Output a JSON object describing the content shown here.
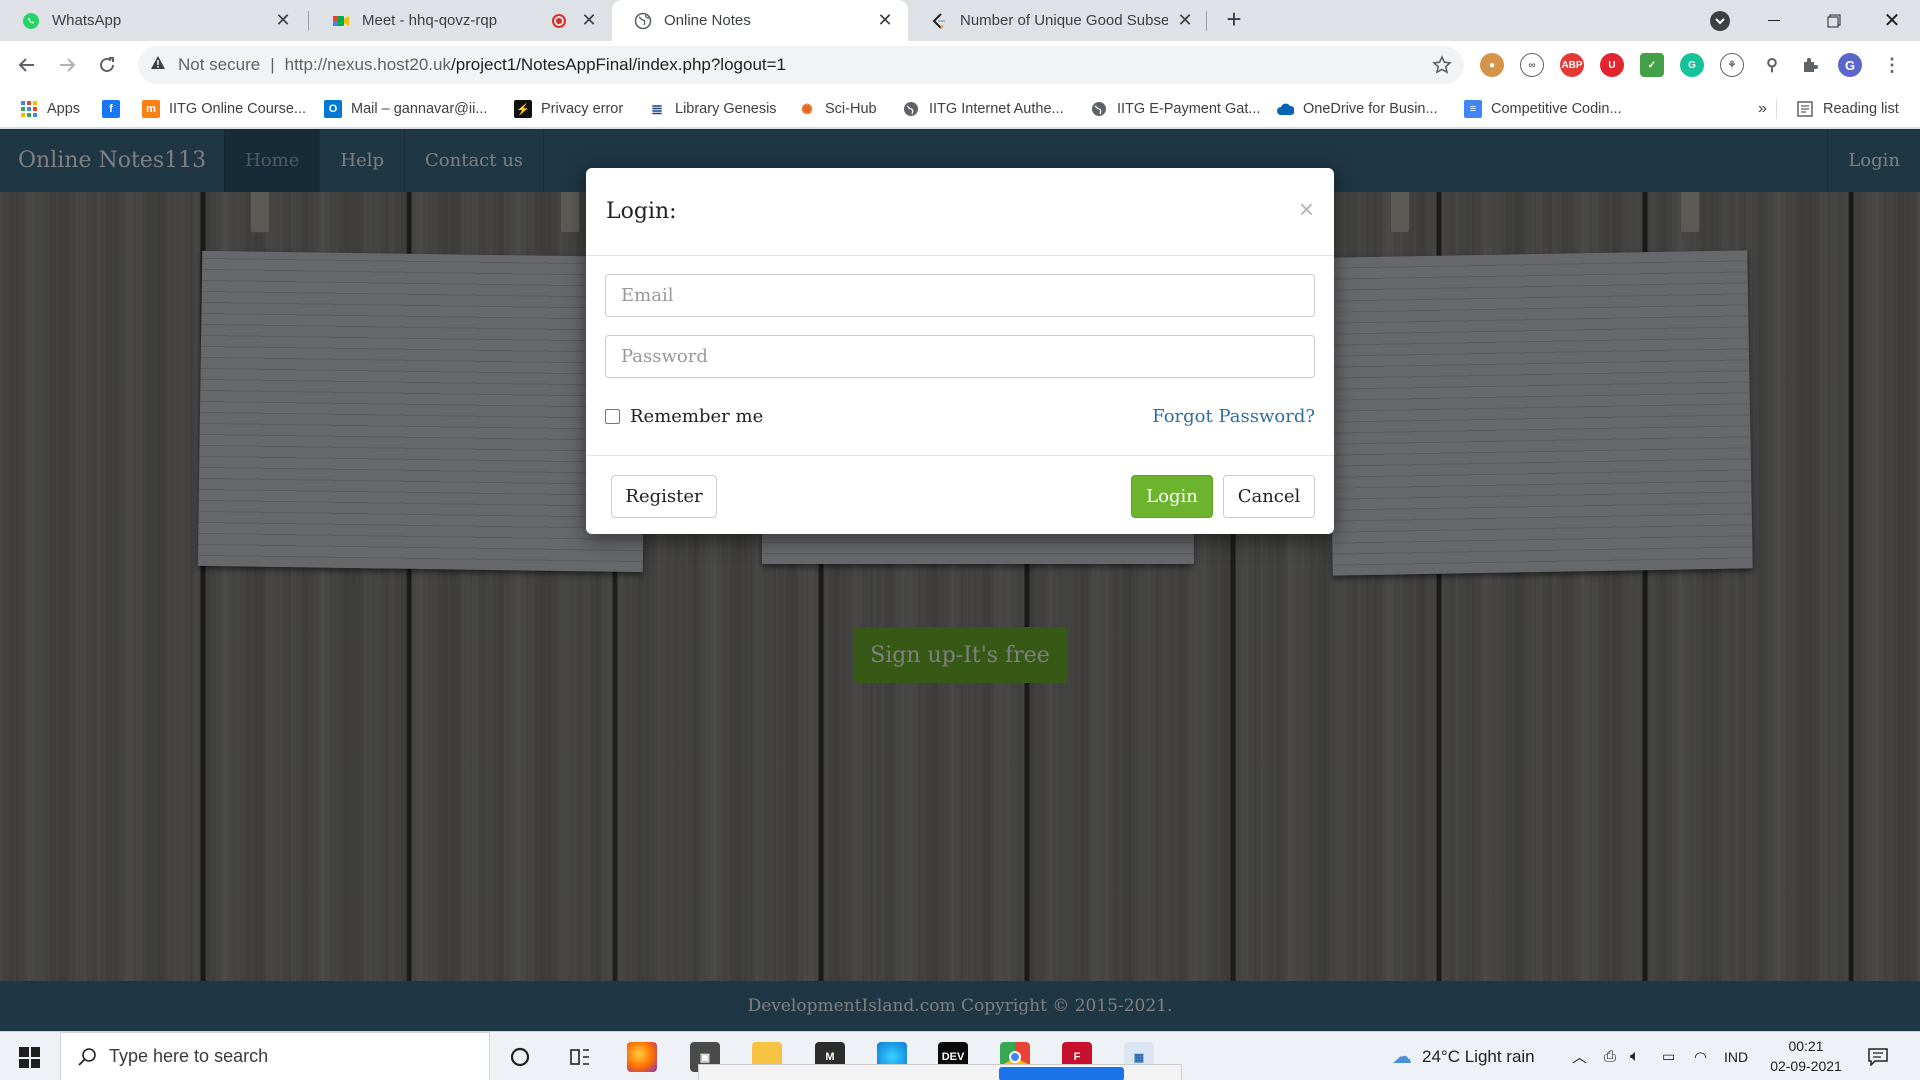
{
  "browser": {
    "tabs": [
      {
        "title": "WhatsApp",
        "icon": "whatsapp-icon",
        "active": false
      },
      {
        "title": "Meet - hhq-qovz-rqp",
        "icon": "google-meet-icon",
        "active": false
      },
      {
        "title": "Online Notes",
        "icon": "globe-icon",
        "active": true
      },
      {
        "title": "Number of Unique Good Subseq",
        "icon": "leetcode-icon",
        "active": false
      }
    ],
    "omnibox": {
      "security_label": "Not secure",
      "url_host": "http://nexus.host20.uk",
      "url_path": "/project1/NotesAppFinal/index.php?logout=1"
    },
    "bookmarks": [
      {
        "label": "Apps",
        "icon": "apps-grid-icon"
      },
      {
        "label": "",
        "icon": "facebook-icon"
      },
      {
        "label": "IITG Online Course...",
        "icon": "moodle-icon"
      },
      {
        "label": "Mail – gannavar@ii...",
        "icon": "outlook-icon"
      },
      {
        "label": "Privacy error",
        "icon": "privacy-error-icon"
      },
      {
        "label": "Library Genesis",
        "icon": "library-genesis-icon"
      },
      {
        "label": "Sci-Hub",
        "icon": "sci-hub-icon"
      },
      {
        "label": "IITG Internet Authe...",
        "icon": "globe-icon"
      },
      {
        "label": "IITG E-Payment Gat...",
        "icon": "globe-icon"
      },
      {
        "label": "OneDrive for Busin...",
        "icon": "onedrive-icon"
      },
      {
        "label": "Competitive Codin...",
        "icon": "docs-icon"
      }
    ],
    "bookmarks_overflow": "»",
    "reading_list": "Reading list",
    "profile_initial": "G"
  },
  "site": {
    "brand": "Online Notes113",
    "nav": [
      "Home",
      "Help",
      "Contact us"
    ],
    "nav_right": "Login",
    "signup_button": "Sign up-It's free",
    "footer": "DevelopmentIsland.com Copyright © 2015-2021."
  },
  "modal": {
    "title": "Login:",
    "close": "×",
    "email_placeholder": "Email",
    "password_placeholder": "Password",
    "remember_label": "Remember me",
    "forgot_link": "Forgot Password?",
    "register_button": "Register",
    "login_button": "Login",
    "cancel_button": "Cancel"
  },
  "taskbar": {
    "search_placeholder": "Type here to search",
    "weather": "24°C  Light rain",
    "language": "IND",
    "time": "00:21",
    "date": "02-09-2021"
  },
  "colors": {
    "nav_blue": "#3f6c8a",
    "accent_green": "#6cb42d",
    "link_blue": "#2d6fa3"
  }
}
